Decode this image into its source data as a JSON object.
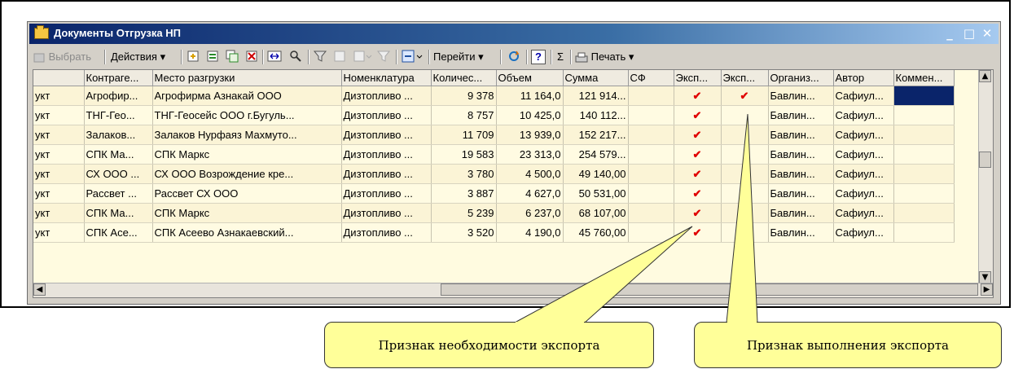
{
  "window": {
    "title": "Документы Отгрузка НП",
    "minimize": "_",
    "maximize": "□",
    "close": "✕"
  },
  "toolbar": {
    "select": "Выбрать",
    "actions": "Действия ▾",
    "goto": "Перейти ▾",
    "sum": "Σ",
    "help": "?",
    "print": "Печать ▾"
  },
  "table": {
    "headers": [
      "",
      "Контраге...",
      "Место разгрузки",
      "Номенклатура",
      "Количес...",
      "Объем",
      "Сумма",
      "СФ",
      "Эксп...",
      "Эксп...",
      "Организ...",
      "Автор",
      "Коммен..."
    ],
    "rows": [
      {
        "c0": "укт",
        "c1": "Агрофир...",
        "c2": "Агрофирма Азнакай ООО",
        "c3": "Дизтопливо ...",
        "c4": "9 378",
        "c5": "11 164,0",
        "c6": "121 914...",
        "c7": "",
        "c8": "✔",
        "c9": "✔",
        "c10": "Бавлин...",
        "c11": "Сафиул...",
        "c12": ""
      },
      {
        "c0": "укт",
        "c1": "ТНГ-Гео...",
        "c2": "ТНГ-Геосейс ООО г.Бугуль...",
        "c3": "Дизтопливо ...",
        "c4": "8 757",
        "c5": "10 425,0",
        "c6": "140 112...",
        "c7": "",
        "c8": "✔",
        "c9": "",
        "c10": "Бавлин...",
        "c11": "Сафиул...",
        "c12": ""
      },
      {
        "c0": "укт",
        "c1": "Залаков...",
        "c2": "Залаков Нурфаяз Махмуто...",
        "c3": "Дизтопливо ...",
        "c4": "11 709",
        "c5": "13 939,0",
        "c6": "152 217...",
        "c7": "",
        "c8": "✔",
        "c9": "",
        "c10": "Бавлин...",
        "c11": "Сафиул...",
        "c12": ""
      },
      {
        "c0": "укт",
        "c1": "СПК Ма...",
        "c2": "СПК Маркс",
        "c3": "Дизтопливо ...",
        "c4": "19 583",
        "c5": "23 313,0",
        "c6": "254 579...",
        "c7": "",
        "c8": "✔",
        "c9": "",
        "c10": "Бавлин...",
        "c11": "Сафиул...",
        "c12": ""
      },
      {
        "c0": "укт",
        "c1": "СХ ООО ...",
        "c2": "СХ ООО Возрождение кре...",
        "c3": "Дизтопливо ...",
        "c4": "3 780",
        "c5": "4 500,0",
        "c6": "49 140,00",
        "c7": "",
        "c8": "✔",
        "c9": "",
        "c10": "Бавлин...",
        "c11": "Сафиул...",
        "c12": ""
      },
      {
        "c0": "укт",
        "c1": "Рассвет ...",
        "c2": "Рассвет СХ ООО",
        "c3": "Дизтопливо ...",
        "c4": "3 887",
        "c5": "4 627,0",
        "c6": "50 531,00",
        "c7": "",
        "c8": "✔",
        "c9": "",
        "c10": "Бавлин...",
        "c11": "Сафиул...",
        "c12": ""
      },
      {
        "c0": "укт",
        "c1": "СПК Ма...",
        "c2": "СПК Маркс",
        "c3": "Дизтопливо ...",
        "c4": "5 239",
        "c5": "6 237,0",
        "c6": "68 107,00",
        "c7": "",
        "c8": "✔",
        "c9": "",
        "c10": "Бавлин...",
        "c11": "Сафиул...",
        "c12": ""
      },
      {
        "c0": "укт",
        "c1": "СПК Асе...",
        "c2": "СПК Асеево Азнакаевский...",
        "c3": "Дизтопливо ...",
        "c4": "3 520",
        "c5": "4 190,0",
        "c6": "45 760,00",
        "c7": "",
        "c8": "✔",
        "c9": "",
        "c10": "Бавлин...",
        "c11": "Сафиул...",
        "c12": ""
      }
    ]
  },
  "callouts": {
    "need_export": "Признак необходимости экспорта",
    "done_export": "Признак выполнения экспорта"
  },
  "colors": {
    "title_bar": "#0a246a",
    "callout_fill": "#ffff99",
    "check_mark": "#e00000"
  }
}
